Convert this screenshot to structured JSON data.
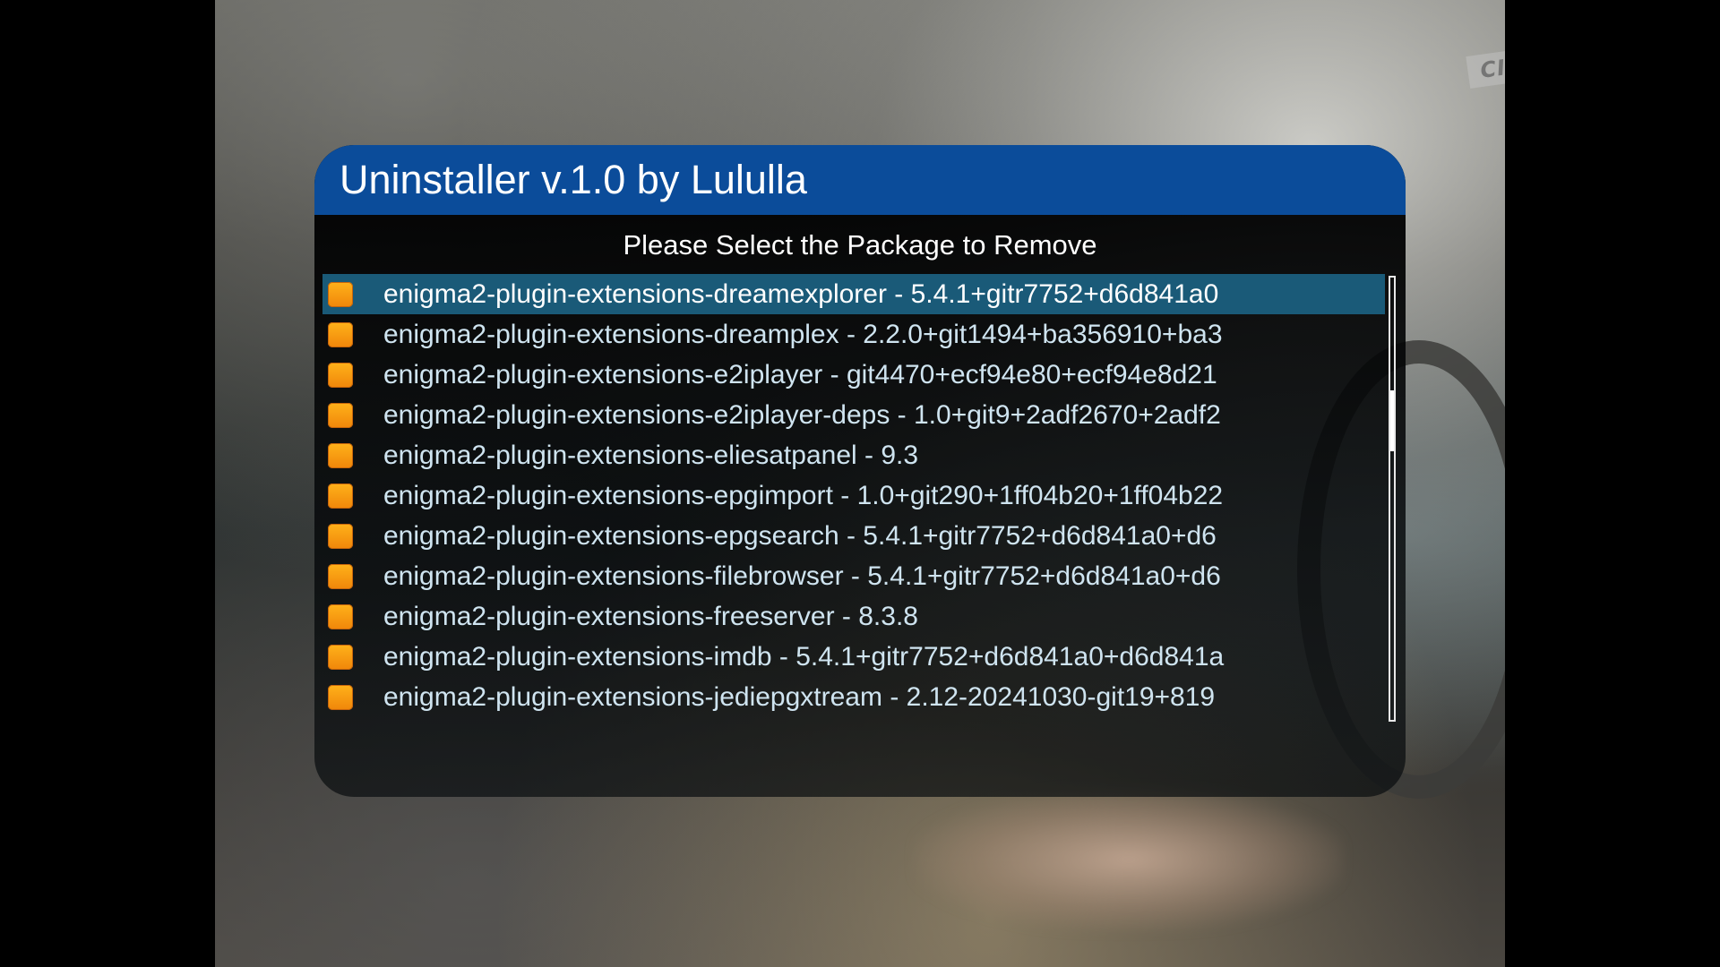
{
  "background": {
    "watermark": "CINEMAX"
  },
  "dialog": {
    "title": "Uninstaller v.1.0 by Lululla",
    "subtitle": "Please Select the Package to Remove",
    "title_color": "#0b4c9a",
    "selected_row_color": "#1a5a78",
    "package_icon": "orange-package-icon",
    "selected_index": 0,
    "packages": [
      "enigma2-plugin-extensions-dreamexplorer - 5.4.1+gitr7752+d6d841a0",
      "enigma2-plugin-extensions-dreamplex - 2.2.0+git1494+ba356910+ba3",
      "enigma2-plugin-extensions-e2iplayer - git4470+ecf94e80+ecf94e8d21",
      "enigma2-plugin-extensions-e2iplayer-deps - 1.0+git9+2adf2670+2adf2",
      "enigma2-plugin-extensions-eliesatpanel - 9.3",
      "enigma2-plugin-extensions-epgimport - 1.0+git290+1ff04b20+1ff04b22",
      "enigma2-plugin-extensions-epgsearch - 5.4.1+gitr7752+d6d841a0+d6",
      "enigma2-plugin-extensions-filebrowser - 5.4.1+gitr7752+d6d841a0+d6",
      "enigma2-plugin-extensions-freeserver - 8.3.8",
      "enigma2-plugin-extensions-imdb - 5.4.1+gitr7752+d6d841a0+d6d841a",
      "enigma2-plugin-extensions-jediepgxtream - 2.12-20241030-git19+819"
    ]
  }
}
